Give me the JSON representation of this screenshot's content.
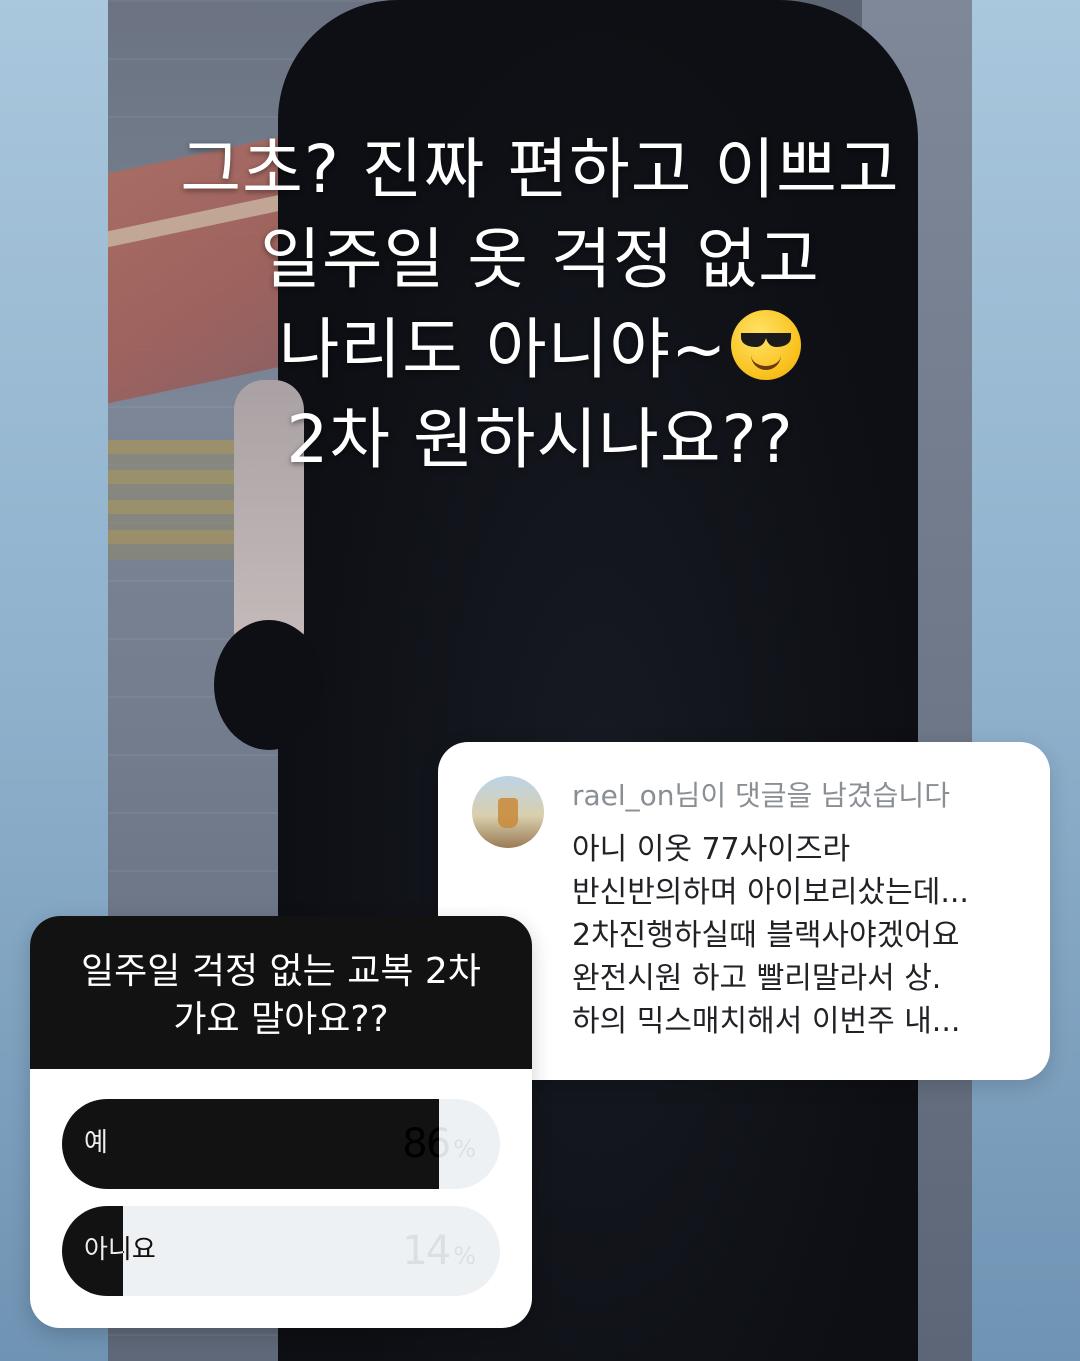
{
  "story": {
    "text_lines": [
      "그초? 진짜 편하고 이쁘고",
      "일주일 옷 걱정 없고",
      "나리도 아니야~",
      "2차 원하시나요??"
    ],
    "emoji_icon": "smiling-face-with-sunglasses-icon"
  },
  "comment": {
    "username_line": "rael_on님이 댓글을 남겼습니다",
    "body_lines": [
      "아니 이옷 77사이즈라",
      "반신반의하며 아이보리샀는데...",
      "2차진행하실때 블랙사야겠어요",
      "완전시원 하고 빨리말라서  상.",
      "하의 믹스매치해서 이번주 내..."
    ]
  },
  "poll": {
    "question_lines": [
      "일주일 걱정 없는 교복 2차",
      "가요 말아요??"
    ],
    "options": [
      {
        "label": "예",
        "percent": 86,
        "percent_text": "86",
        "percent_sign": "%"
      },
      {
        "label": "아니요",
        "percent": 14,
        "percent_text": "14",
        "percent_sign": "%"
      }
    ],
    "colors": {
      "fill": "#121212",
      "track": "#eef1f4",
      "header": "#121212"
    }
  }
}
